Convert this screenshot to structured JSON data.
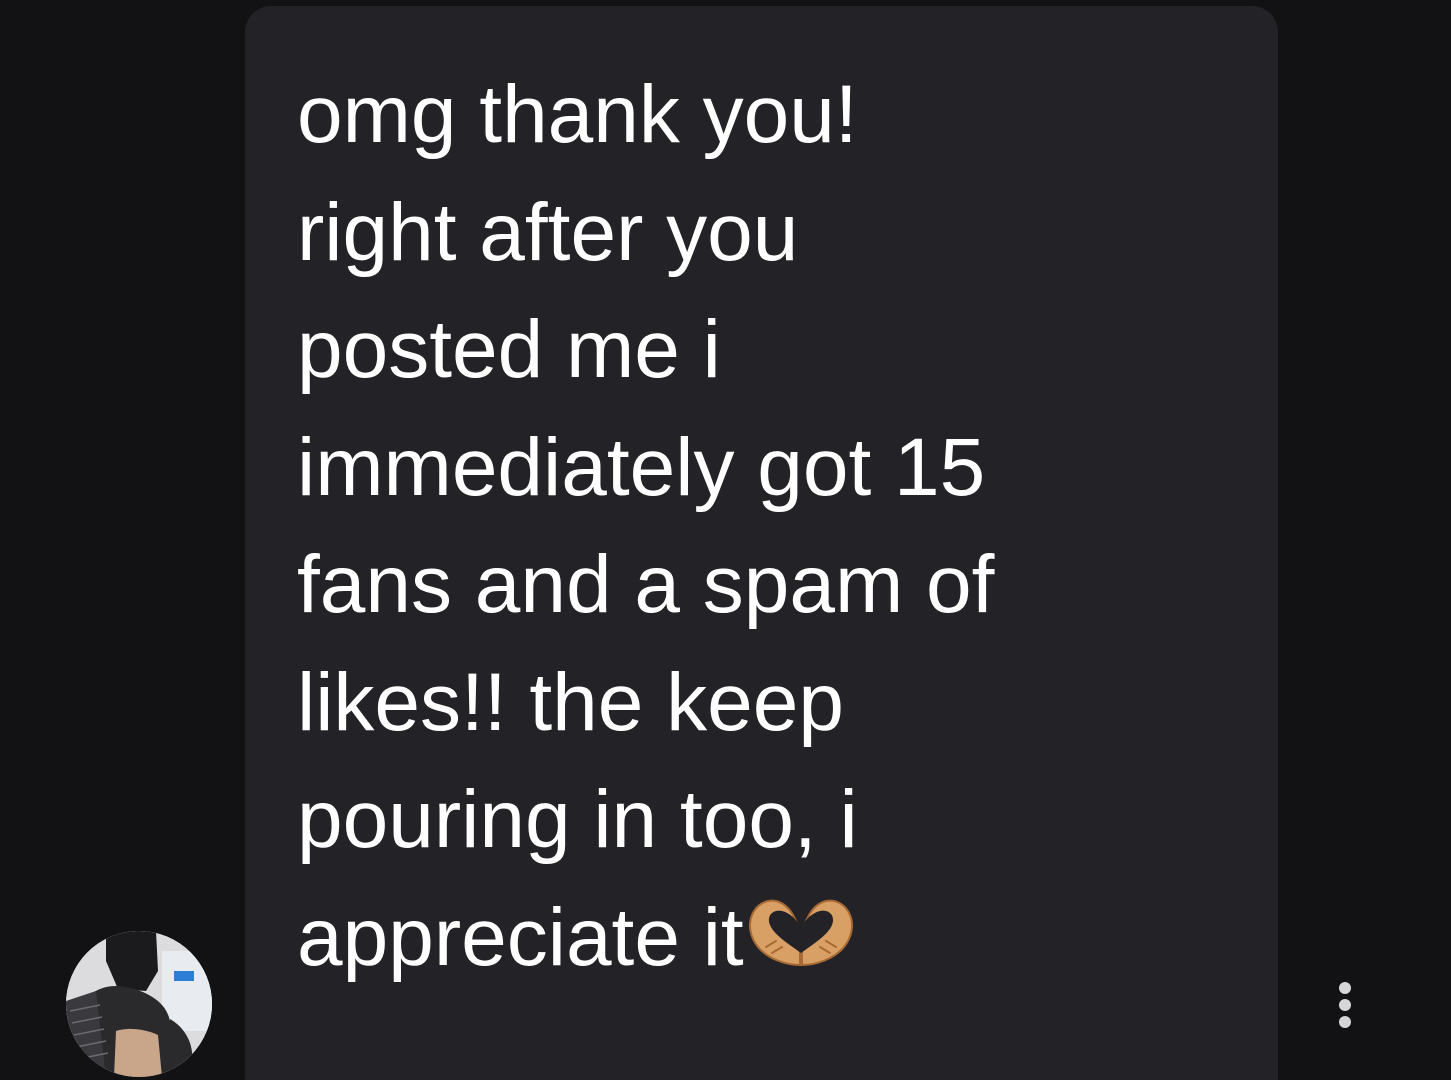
{
  "message": {
    "lines": [
      "omg thank you!",
      "right after you",
      "posted me i",
      "immediately got 15",
      "fans and a spam of",
      "likes!! the keep",
      "pouring in too, i",
      "appreciate it"
    ],
    "trailing_icon": "heart-hands-emoji"
  },
  "avatar": {
    "icon": "profile-photo"
  },
  "more_options": {
    "icon": "vertical-ellipsis-icon"
  },
  "colors": {
    "background": "#121214",
    "bubble": "#232327",
    "text": "#ffffff",
    "more_dots": "#d6d6d8"
  }
}
